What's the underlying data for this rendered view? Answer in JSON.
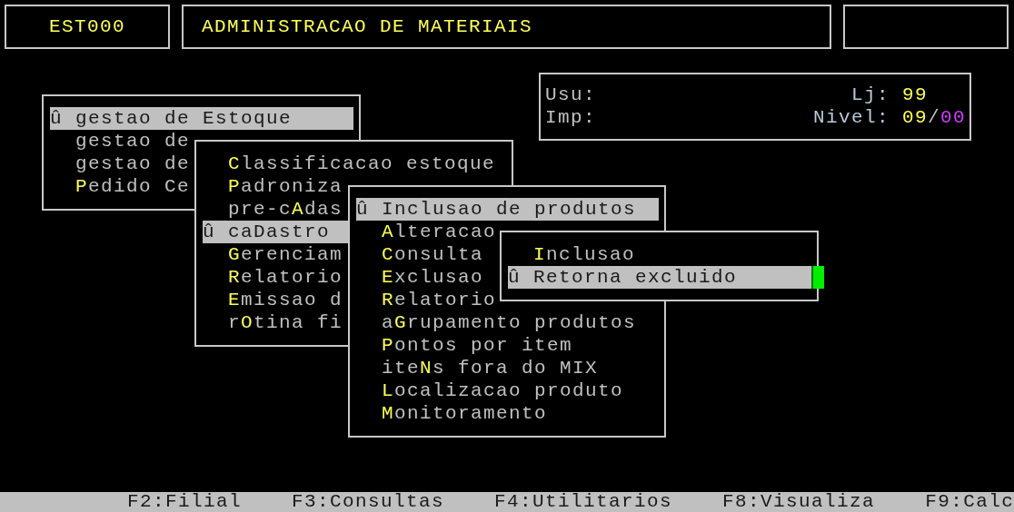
{
  "header": {
    "program": "EST000",
    "title": "ADMINISTRACAO DE MATERIAIS"
  },
  "session": {
    "rows": [
      {
        "left_label": "Usu:",
        "right_label": "Lj:",
        "right_value": [
          {
            "text": "99",
            "color": "#ffff55"
          }
        ]
      },
      {
        "left_label": "Imp:",
        "right_label": "Nivel:",
        "right_value": [
          {
            "text": "09",
            "color": "#ffff55"
          },
          {
            "text": "/",
            "color": "#c0c0c0"
          },
          {
            "text": "00",
            "color": "#d63cff"
          }
        ]
      }
    ]
  },
  "menus": [
    {
      "marker": "û",
      "cursor": false,
      "items": [
        {
          "selected": true,
          "parts": [
            {
              "text": "gestao de Estoque",
              "hot": false
            }
          ]
        },
        {
          "selected": false,
          "parts": [
            {
              "text": "gestao de",
              "hot": false
            }
          ]
        },
        {
          "selected": false,
          "parts": [
            {
              "text": "gestao de",
              "hot": false
            }
          ]
        },
        {
          "selected": false,
          "parts": [
            {
              "text": "P",
              "hot": true
            },
            {
              "text": "edido Ce",
              "hot": false
            }
          ]
        }
      ]
    },
    {
      "marker": "û",
      "cursor": false,
      "items": [
        {
          "selected": false,
          "parts": [
            {
              "text": "C",
              "hot": true
            },
            {
              "text": "lassificacao estoque",
              "hot": false
            }
          ]
        },
        {
          "selected": false,
          "parts": [
            {
              "text": "P",
              "hot": true
            },
            {
              "text": "adroniza",
              "hot": false
            }
          ]
        },
        {
          "selected": false,
          "parts": [
            {
              "text": "pre-c",
              "hot": false
            },
            {
              "text": "A",
              "hot": true
            },
            {
              "text": "das",
              "hot": false
            }
          ]
        },
        {
          "selected": true,
          "parts": [
            {
              "text": "caDastro",
              "hot": false
            }
          ]
        },
        {
          "selected": false,
          "parts": [
            {
              "text": "G",
              "hot": true
            },
            {
              "text": "erenciam",
              "hot": false
            }
          ]
        },
        {
          "selected": false,
          "parts": [
            {
              "text": "R",
              "hot": true
            },
            {
              "text": "elatorio",
              "hot": false
            }
          ]
        },
        {
          "selected": false,
          "parts": [
            {
              "text": "E",
              "hot": true
            },
            {
              "text": "missao d",
              "hot": false
            }
          ]
        },
        {
          "selected": false,
          "parts": [
            {
              "text": "r",
              "hot": false
            },
            {
              "text": "O",
              "hot": true
            },
            {
              "text": "tina fi",
              "hot": false
            }
          ]
        }
      ]
    },
    {
      "marker": "û",
      "cursor": false,
      "items": [
        {
          "selected": true,
          "parts": [
            {
              "text": "Inclusao de produtos",
              "hot": false
            }
          ]
        },
        {
          "selected": false,
          "parts": [
            {
              "text": "A",
              "hot": true
            },
            {
              "text": "lteracao",
              "hot": false
            }
          ]
        },
        {
          "selected": false,
          "parts": [
            {
              "text": "C",
              "hot": true
            },
            {
              "text": "onsulta",
              "hot": false
            }
          ]
        },
        {
          "selected": false,
          "parts": [
            {
              "text": "E",
              "hot": true
            },
            {
              "text": "xclusao",
              "hot": false
            }
          ]
        },
        {
          "selected": false,
          "parts": [
            {
              "text": "R",
              "hot": true
            },
            {
              "text": "elatorio",
              "hot": false
            }
          ]
        },
        {
          "selected": false,
          "parts": [
            {
              "text": "a",
              "hot": false
            },
            {
              "text": "G",
              "hot": true
            },
            {
              "text": "rupamento produtos",
              "hot": false
            }
          ]
        },
        {
          "selected": false,
          "parts": [
            {
              "text": "P",
              "hot": true
            },
            {
              "text": "ontos por item",
              "hot": false
            }
          ]
        },
        {
          "selected": false,
          "parts": [
            {
              "text": "ite",
              "hot": false
            },
            {
              "text": "N",
              "hot": true
            },
            {
              "text": "s fora do MIX",
              "hot": false
            }
          ]
        },
        {
          "selected": false,
          "parts": [
            {
              "text": "L",
              "hot": true
            },
            {
              "text": "ocalizacao produto",
              "hot": false
            }
          ]
        },
        {
          "selected": false,
          "parts": [
            {
              "text": "M",
              "hot": true
            },
            {
              "text": "onitoramento",
              "hot": false
            }
          ]
        }
      ]
    },
    {
      "marker": "û",
      "cursor": true,
      "items": [
        {
          "selected": false,
          "parts": [
            {
              "text": "I",
              "hot": true
            },
            {
              "text": "nclusao",
              "hot": false
            }
          ]
        },
        {
          "selected": true,
          "parts": [
            {
              "text": "Retorna excluido",
              "hot": false
            }
          ]
        }
      ]
    }
  ],
  "function_keys": [
    "F2:Filial",
    "F3:Consultas",
    "F4:Utilitarios",
    "F8:Visualiza",
    "F9:Calc"
  ]
}
